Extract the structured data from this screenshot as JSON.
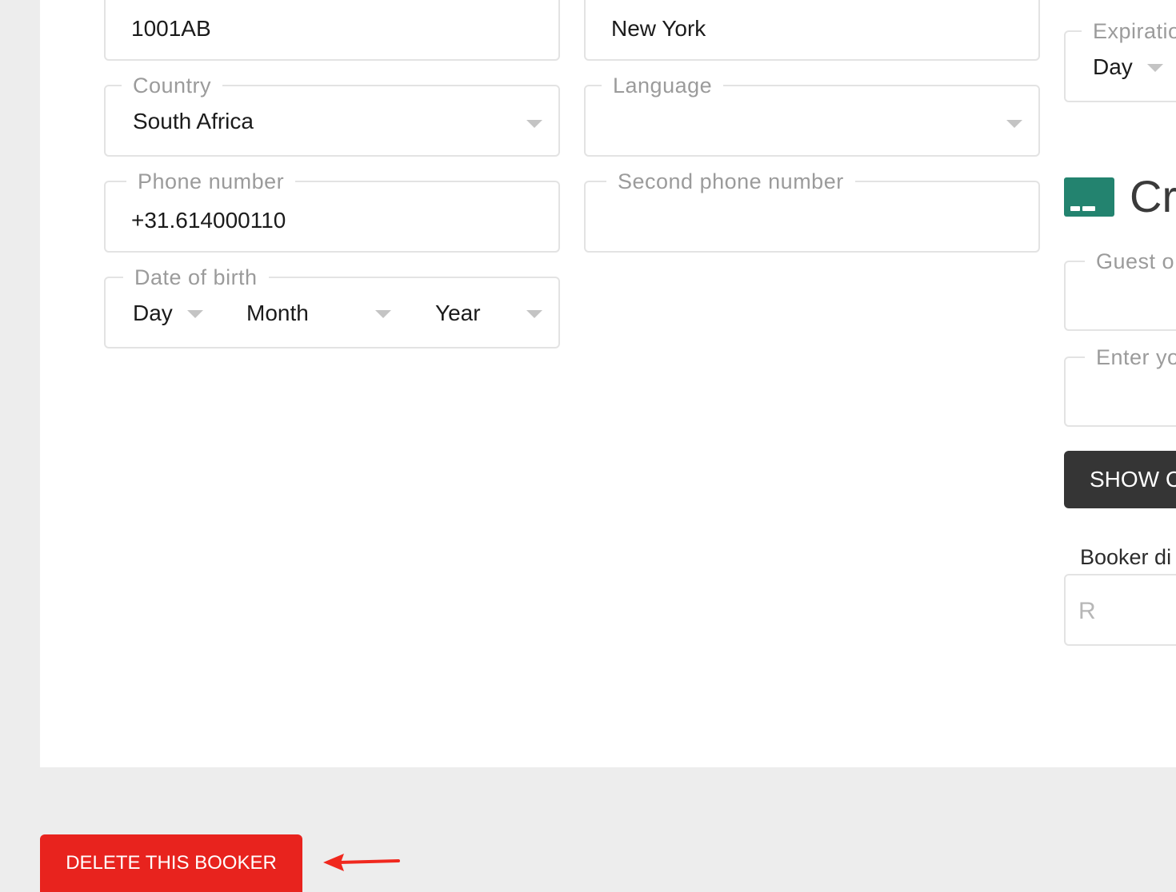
{
  "form": {
    "postal_code": {
      "value": "1001AB"
    },
    "city": {
      "value": "New York"
    },
    "country": {
      "label": "Country",
      "value": "South Africa"
    },
    "language": {
      "label": "Language",
      "value": ""
    },
    "phone": {
      "label": "Phone number",
      "value": "+31.614000110"
    },
    "second_phone": {
      "label": "Second phone number",
      "value": ""
    },
    "dob": {
      "label": "Date of birth",
      "day": "Day",
      "month": "Month",
      "year": "Year"
    }
  },
  "right_column": {
    "expiration": {
      "label": "Expiratio",
      "day": "Day"
    },
    "credit_card_title": "Cr",
    "guest_label": "Guest o",
    "enter_label": "Enter yo",
    "show_button": "SHOW C",
    "booker_label": "Booker di",
    "booker_placeholder": "R"
  },
  "actions": {
    "delete_button": "DELETE THIS BOOKER"
  },
  "colors": {
    "accent_green": "#23836f",
    "danger_red": "#e8231e",
    "annotation_arrow": "#f0281e"
  },
  "icons": [
    "chevron-down-icon",
    "credit-card-icon",
    "arrow-left-icon"
  ]
}
